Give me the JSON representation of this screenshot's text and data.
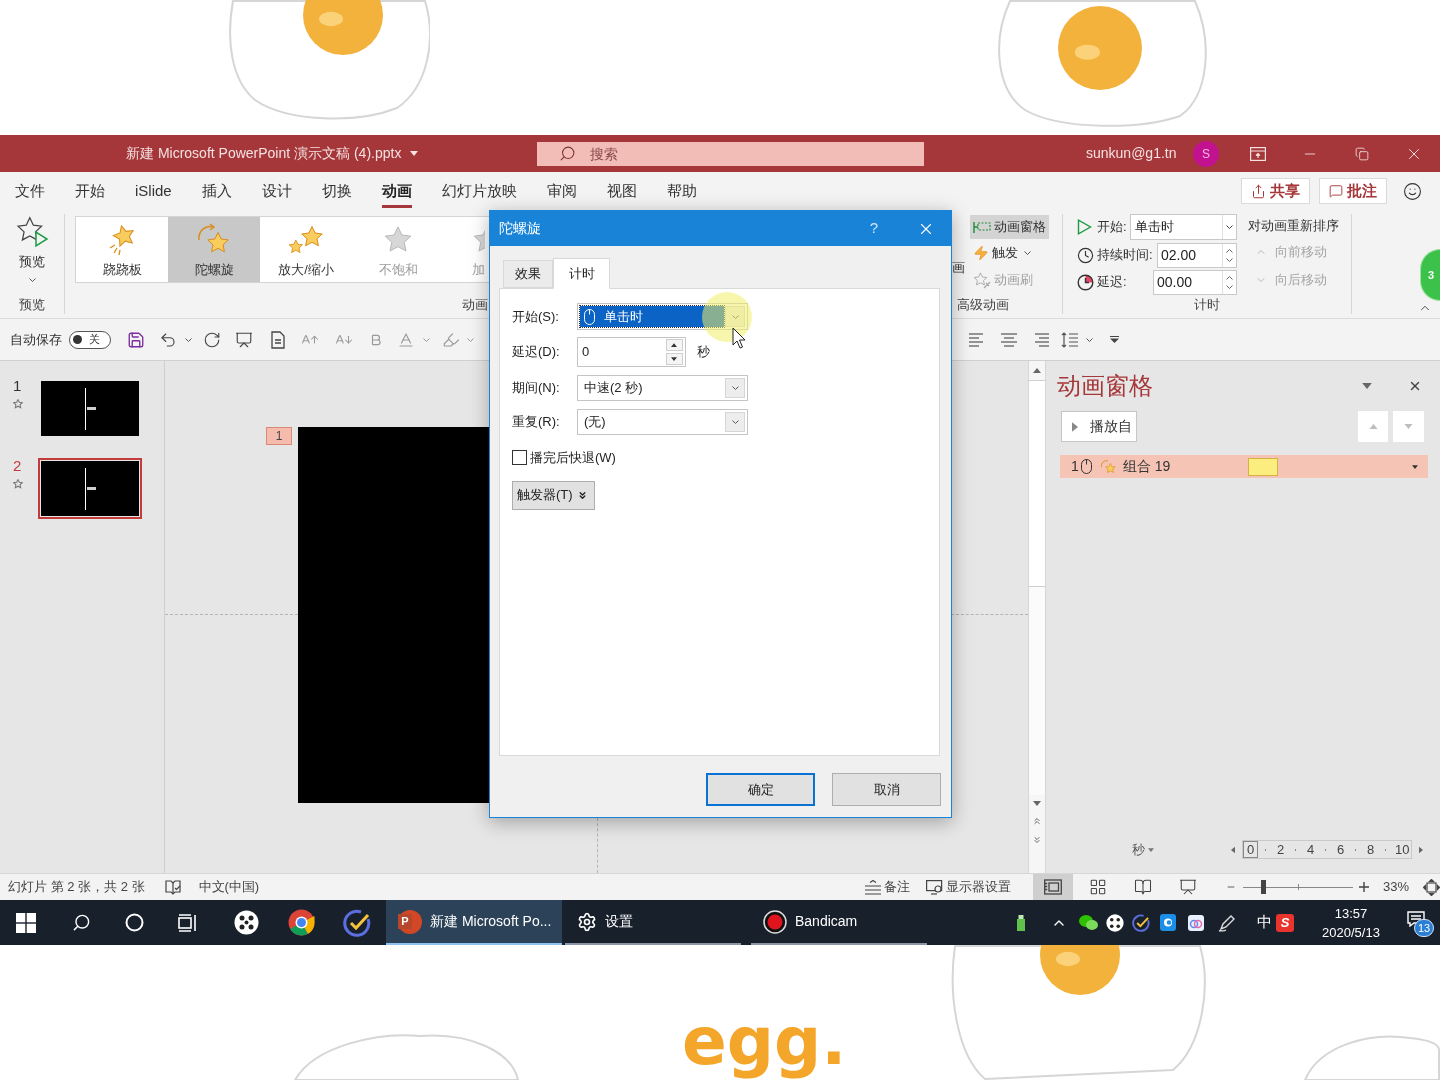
{
  "frame": {
    "logo": "egg."
  },
  "window": {
    "title": "新建 Microsoft PowerPoint 演示文稿 (4).pptx",
    "search": {
      "placeholder": "搜索"
    },
    "user": "sunkun@g1.tn",
    "avatar": "S"
  },
  "tabs": [
    {
      "label": "文件",
      "selected": false
    },
    {
      "label": "开始",
      "selected": false
    },
    {
      "label": "iSlide",
      "selected": false
    },
    {
      "label": "插入",
      "selected": false
    },
    {
      "label": "设计",
      "selected": false
    },
    {
      "label": "切换",
      "selected": false
    },
    {
      "label": "动画",
      "selected": true
    },
    {
      "label": "幻灯片放映",
      "selected": false
    },
    {
      "label": "审阅",
      "selected": false
    },
    {
      "label": "视图",
      "selected": false
    },
    {
      "label": "帮助",
      "selected": false
    }
  ],
  "header_buttons": [
    {
      "kind": "share",
      "label": "共享"
    },
    {
      "kind": "comment",
      "label": "批注"
    }
  ],
  "ribbon": {
    "preview": {
      "label": "预览",
      "group_label": "预览"
    },
    "gallery": [
      {
        "kind": "teeter",
        "label": "跷跷板",
        "selected": false,
        "disabled": false
      },
      {
        "kind": "spin",
        "label": "陀螺旋",
        "selected": true,
        "disabled": false
      },
      {
        "kind": "grow",
        "label": "放大/缩小",
        "selected": false,
        "disabled": false
      },
      {
        "kind": "desaturate",
        "label": "不饱和",
        "selected": false,
        "disabled": true
      },
      {
        "kind": "widen",
        "label": "加",
        "selected": false,
        "disabled": true
      }
    ],
    "animation_group_label": "动画",
    "add_animation_fragment": "画",
    "advanced": [
      {
        "kind": "pane",
        "label": "动画窗格",
        "active": true,
        "disabled": false
      },
      {
        "kind": "trigger",
        "label": "触发",
        "active": false,
        "disabled": false
      },
      {
        "kind": "painter",
        "label": "动画刷",
        "active": false,
        "disabled": true
      }
    ],
    "advanced_group_label": "高级动画",
    "timing": {
      "start_label": "开始:",
      "start_value": "单击时",
      "duration_label": "持续时间:",
      "duration_value": "02.00",
      "delay_label": "延迟:",
      "delay_value": "00.00",
      "group_label": "计时"
    },
    "reorder": {
      "title": "对动画重新排序",
      "items": [
        {
          "kind": "earlier",
          "label": "向前移动",
          "disabled": true
        },
        {
          "kind": "later",
          "label": "向后移动",
          "disabled": true
        }
      ]
    }
  },
  "floating_ball": {
    "text": "3"
  },
  "quick_access": {
    "autosave_label": "自动保存",
    "autosave_on": false,
    "autosave_state": "关"
  },
  "slides": [
    {
      "number": "1",
      "selected": false
    },
    {
      "number": "2",
      "selected": true
    }
  ],
  "canvas": {
    "animation_tag": "1"
  },
  "dialog": {
    "title": "陀螺旋",
    "help": "?",
    "tabs": [
      {
        "label": "效果",
        "selected": false
      },
      {
        "label": "计时",
        "selected": true
      }
    ],
    "fields": [
      {
        "kind": "start",
        "label": "开始(S):",
        "value": "单击时",
        "highlighted": true
      },
      {
        "kind": "spin",
        "label": "延迟(D):",
        "value": "0",
        "unit": "秒"
      },
      {
        "kind": "combo",
        "label": "期间(N):",
        "value": "中速(2 秒)",
        "highlighted": false
      },
      {
        "kind": "combo",
        "label": "重复(R):",
        "value": "(无)",
        "highlighted": false
      }
    ],
    "rewind": {
      "label": "播完后快退(W)",
      "checked": false
    },
    "trigger": "触发器(T)",
    "buttons": [
      {
        "label": "确定",
        "default": true
      },
      {
        "label": "取消",
        "default": false
      }
    ]
  },
  "animation_pane": {
    "title": "动画窗格",
    "play": "播放自",
    "items": [
      {
        "number": "1",
        "name": "组合 19",
        "selected": true
      }
    ],
    "timeline": {
      "unit": "秒",
      "ticks": [
        {
          "label": "0",
          "selected": true
        },
        {
          "label": "2",
          "selected": false
        },
        {
          "label": "4",
          "selected": false
        },
        {
          "label": "6",
          "selected": false
        },
        {
          "label": "8",
          "selected": false
        },
        {
          "label": "10",
          "selected": false
        }
      ]
    }
  },
  "status_bar": {
    "slide_info": "幻灯片 第 2 张，共 2 张",
    "language": "中文(中国)",
    "notes": "备注",
    "display": "显示器设置",
    "views": [
      {
        "kind": "normal",
        "selected": true
      },
      {
        "kind": "sorter",
        "selected": false
      },
      {
        "kind": "reading",
        "selected": false
      },
      {
        "kind": "slideshow",
        "selected": false
      }
    ],
    "zoom": {
      "level": 0.16,
      "text": "33%"
    }
  },
  "taskbar": {
    "windows": [
      {
        "kind": "powerpoint",
        "badge": "P",
        "label": "新建 Microsoft Po...",
        "active": true
      },
      {
        "kind": "settings",
        "label": "设置",
        "active": false
      },
      {
        "kind": "bandicam",
        "label": "Bandicam",
        "active": false
      }
    ],
    "ime": "中",
    "ime_badge": "S",
    "time": "13:57",
    "date": "2020/5/13",
    "notifications": "13"
  }
}
